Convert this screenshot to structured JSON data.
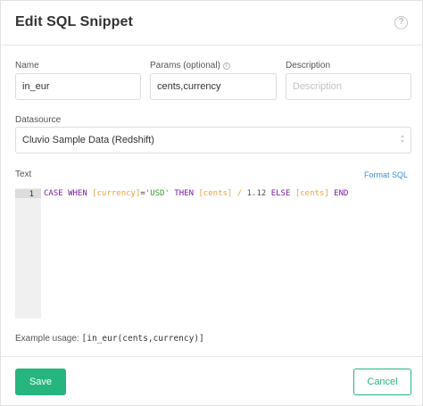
{
  "dialog": {
    "title": "Edit SQL Snippet",
    "help_icon_glyph": "?"
  },
  "fields": {
    "name": {
      "label": "Name",
      "value": "in_eur"
    },
    "params": {
      "label": "Params (optional)",
      "info_glyph": "i",
      "value": "cents,currency"
    },
    "description": {
      "label": "Description",
      "value": "",
      "placeholder": "Description"
    },
    "datasource": {
      "label": "Datasource",
      "selected": "Cluvio Sample Data (Redshift)"
    }
  },
  "editor": {
    "label": "Text",
    "format_link": "Format SQL",
    "line_number": "1",
    "tokens": [
      {
        "text": "CASE WHEN ",
        "type": "kw"
      },
      {
        "text": "[currency]",
        "type": "var"
      },
      {
        "text": "=",
        "type": "plain"
      },
      {
        "text": "'USD'",
        "type": "str"
      },
      {
        "text": " THEN ",
        "type": "kw"
      },
      {
        "text": "[cents]",
        "type": "var"
      },
      {
        "text": " / ",
        "type": "var"
      },
      {
        "text": "1.12",
        "type": "num"
      },
      {
        "text": " ELSE ",
        "type": "kw"
      },
      {
        "text": "[cents]",
        "type": "var"
      },
      {
        "text": " END",
        "type": "kw"
      }
    ]
  },
  "usage": {
    "label": "Example usage:",
    "code": "[in_eur(cents,currency)]"
  },
  "buttons": {
    "save": "Save",
    "cancel": "Cancel"
  },
  "colors": {
    "accent": "#27b57f",
    "link": "#3a8fd6",
    "keyword": "#7a1fa2",
    "variable": "#f0a13a",
    "string": "#3a9a3a"
  }
}
